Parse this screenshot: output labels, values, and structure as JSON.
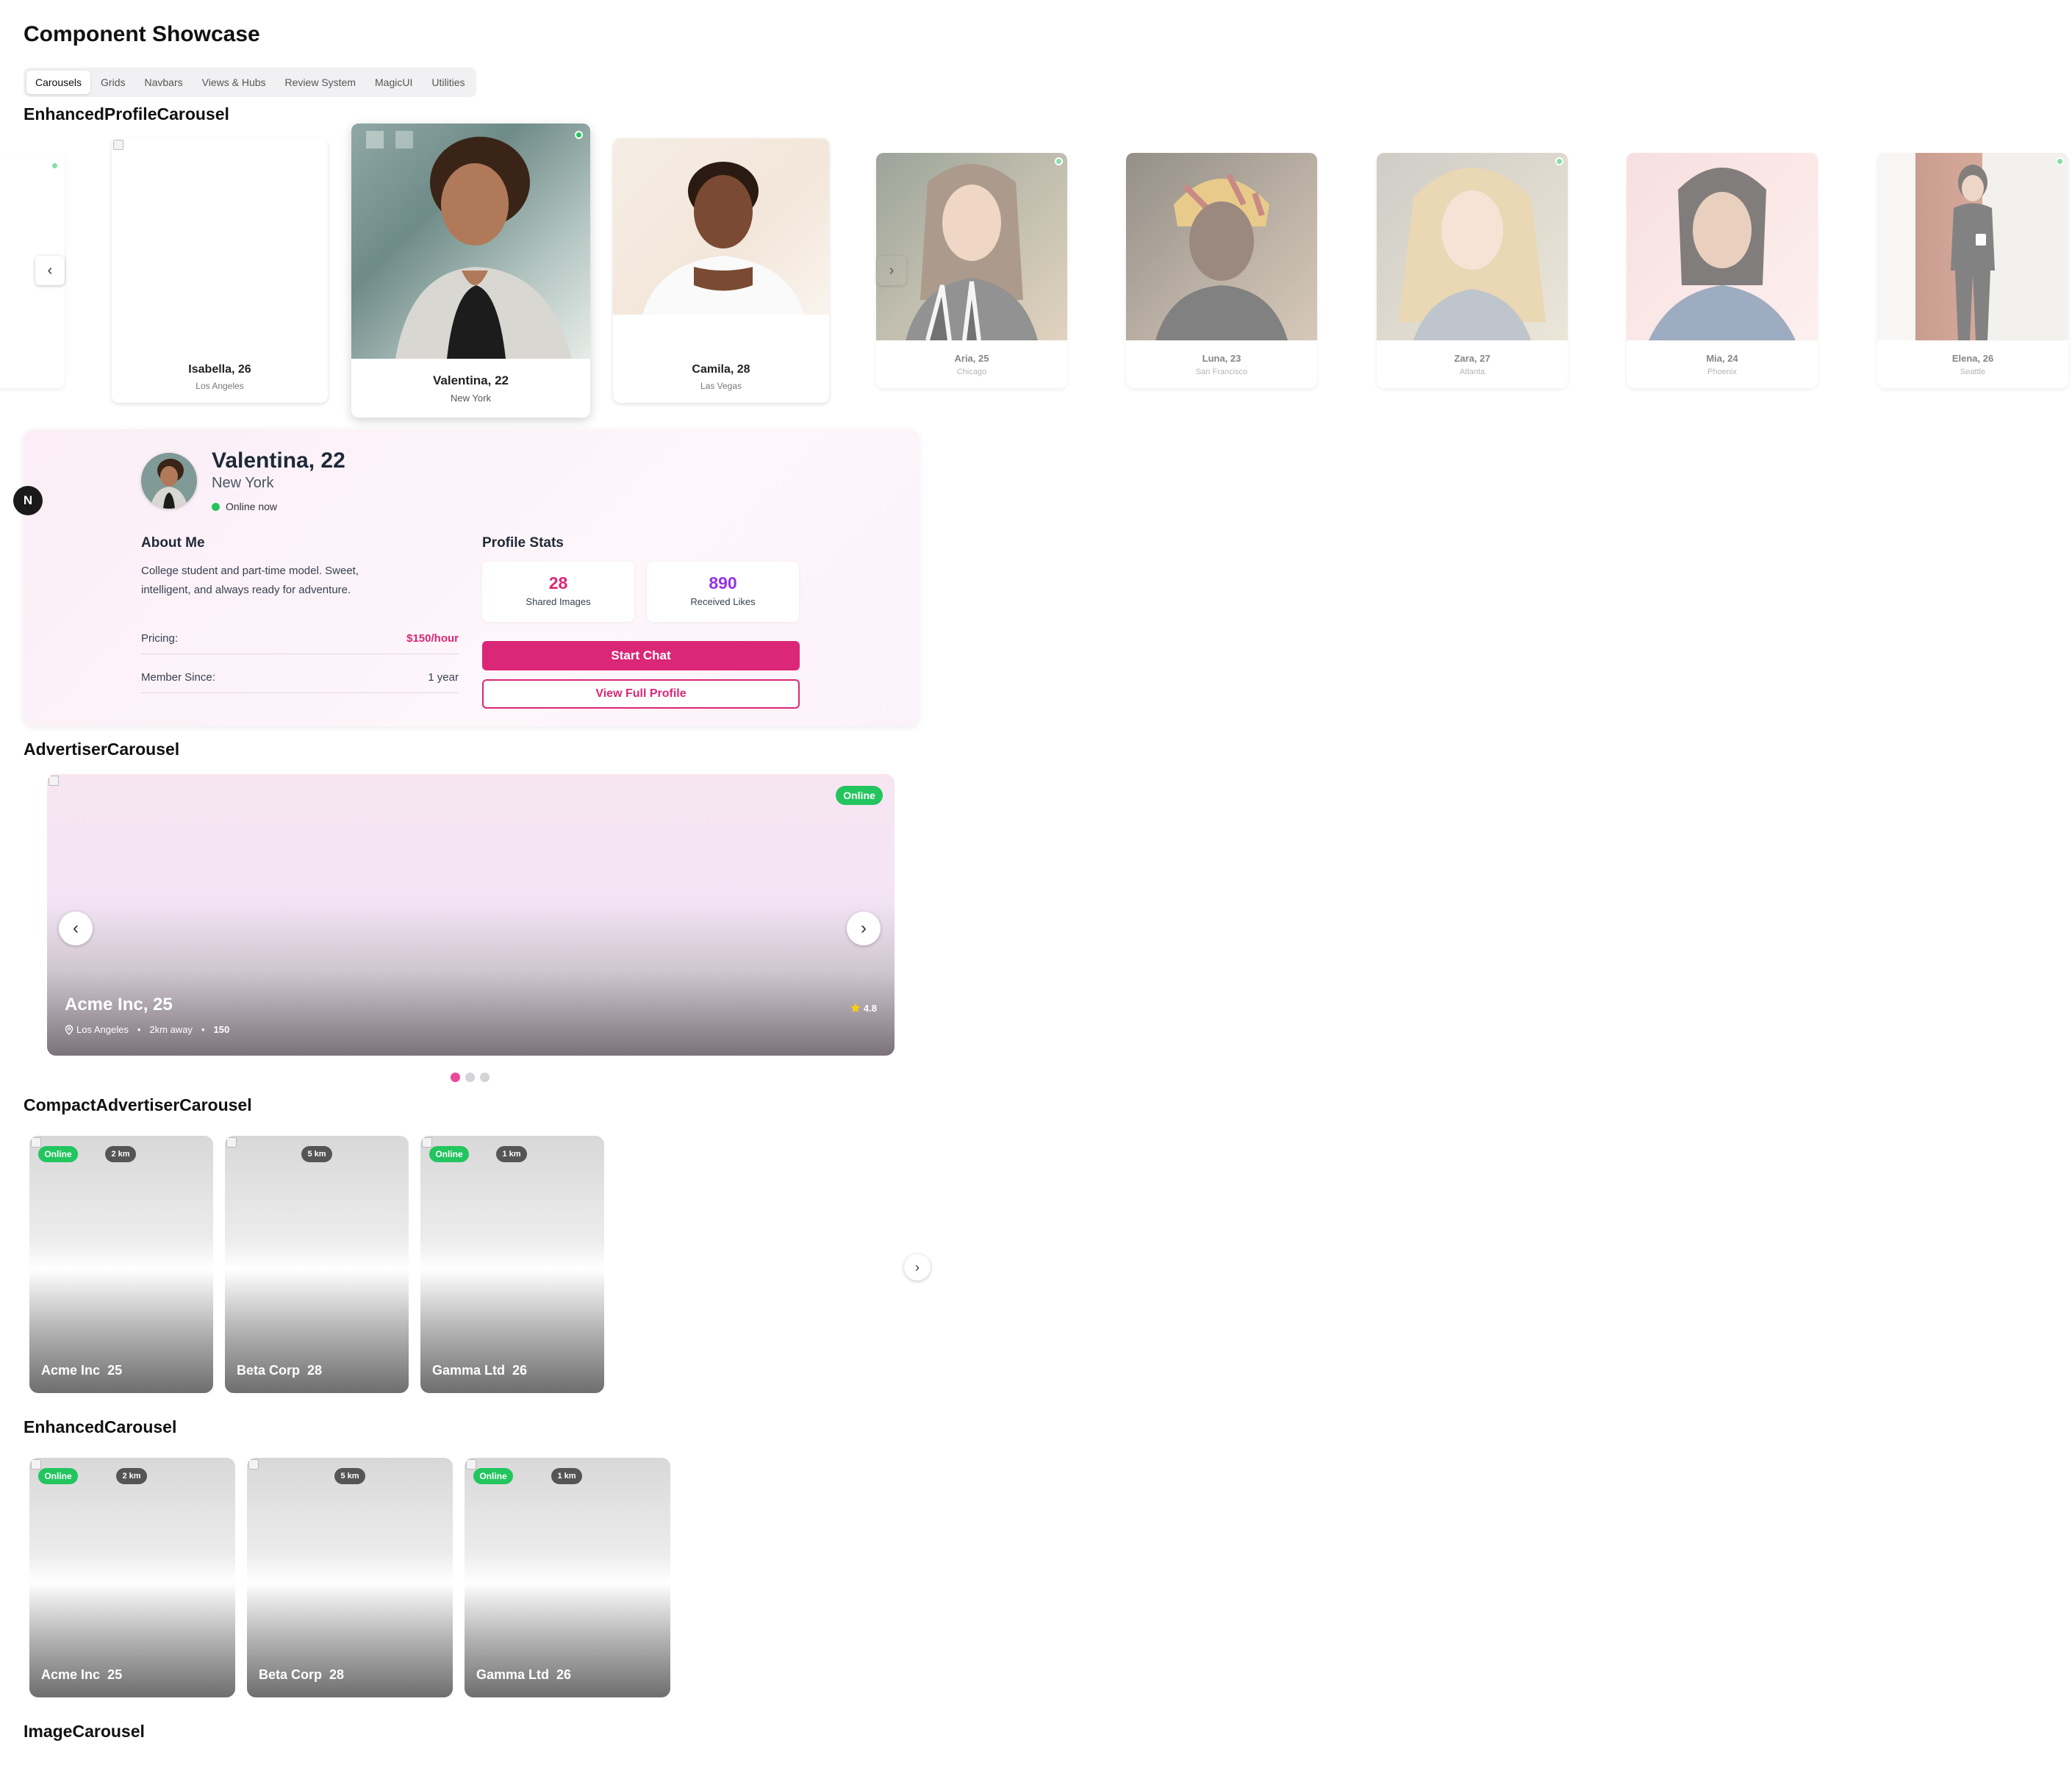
{
  "page": {
    "title": "Component Showcase"
  },
  "tabs": [
    "Carousels",
    "Grids",
    "Navbars",
    "Views & Hubs",
    "Review System",
    "MagicUI",
    "Utilities"
  ],
  "sections": {
    "enhanced_profile": "EnhancedProfileCarousel",
    "advertiser": "AdvertiserCarousel",
    "compact": "CompactAdvertiserCarousel",
    "enhanced": "EnhancedCarousel",
    "image": "ImageCarousel"
  },
  "profiles": [
    {
      "name": "Isabella, 26",
      "city": "Los Angeles"
    },
    {
      "name": "Valentina, 22",
      "city": "New York"
    },
    {
      "name": "Camila, 28",
      "city": "Las Vegas"
    },
    {
      "name": "Aria, 25",
      "city": "Chicago"
    },
    {
      "name": "Luna, 23",
      "city": "San Francisco"
    },
    {
      "name": "Zara, 27",
      "city": "Atlanta"
    },
    {
      "name": "Mia, 24",
      "city": "Phoenix"
    },
    {
      "name": "Elena, 26",
      "city": "Seattle"
    }
  ],
  "detail": {
    "name": "Valentina, 22",
    "city": "New York",
    "status": "Online now",
    "about_title": "About Me",
    "about_text": "College student and part-time model. Sweet, intelligent, and always ready for adventure.",
    "pricing_label": "Pricing:",
    "pricing_value": "$150/hour",
    "member_label": "Member Since:",
    "member_value": "1 year",
    "stats_title": "Profile Stats",
    "stat1_value": "28",
    "stat1_label": "Shared Images",
    "stat2_value": "890",
    "stat2_label": "Received Likes",
    "start_chat": "Start Chat",
    "view_profile": "View Full Profile",
    "next_badge": "N"
  },
  "advertiser": {
    "status": "Online",
    "name": "Acme Inc, 25",
    "location": "Los Angeles",
    "distance": "2km away",
    "count": "150",
    "rating": "4.8",
    "sep": "•"
  },
  "compact_cards": [
    {
      "online": "Online",
      "km": "2 km",
      "name": "Acme Inc",
      "age": "25"
    },
    {
      "online": "",
      "km": "5 km",
      "name": "Beta Corp",
      "age": "28"
    },
    {
      "online": "Online",
      "km": "1 km",
      "name": "Gamma Ltd",
      "age": "26"
    }
  ],
  "enhanced_cards": [
    {
      "online": "Online",
      "km": "2 km",
      "name": "Acme Inc",
      "age": "25"
    },
    {
      "online": "",
      "km": "5 km",
      "name": "Beta Corp",
      "age": "28"
    },
    {
      "online": "Online",
      "km": "1 km",
      "name": "Gamma Ltd",
      "age": "26"
    }
  ],
  "colors": {
    "accent": "#db2777",
    "purple": "#9333ea",
    "online": "#22c55e"
  },
  "glyphs": {
    "prev": "‹",
    "next": "›"
  }
}
